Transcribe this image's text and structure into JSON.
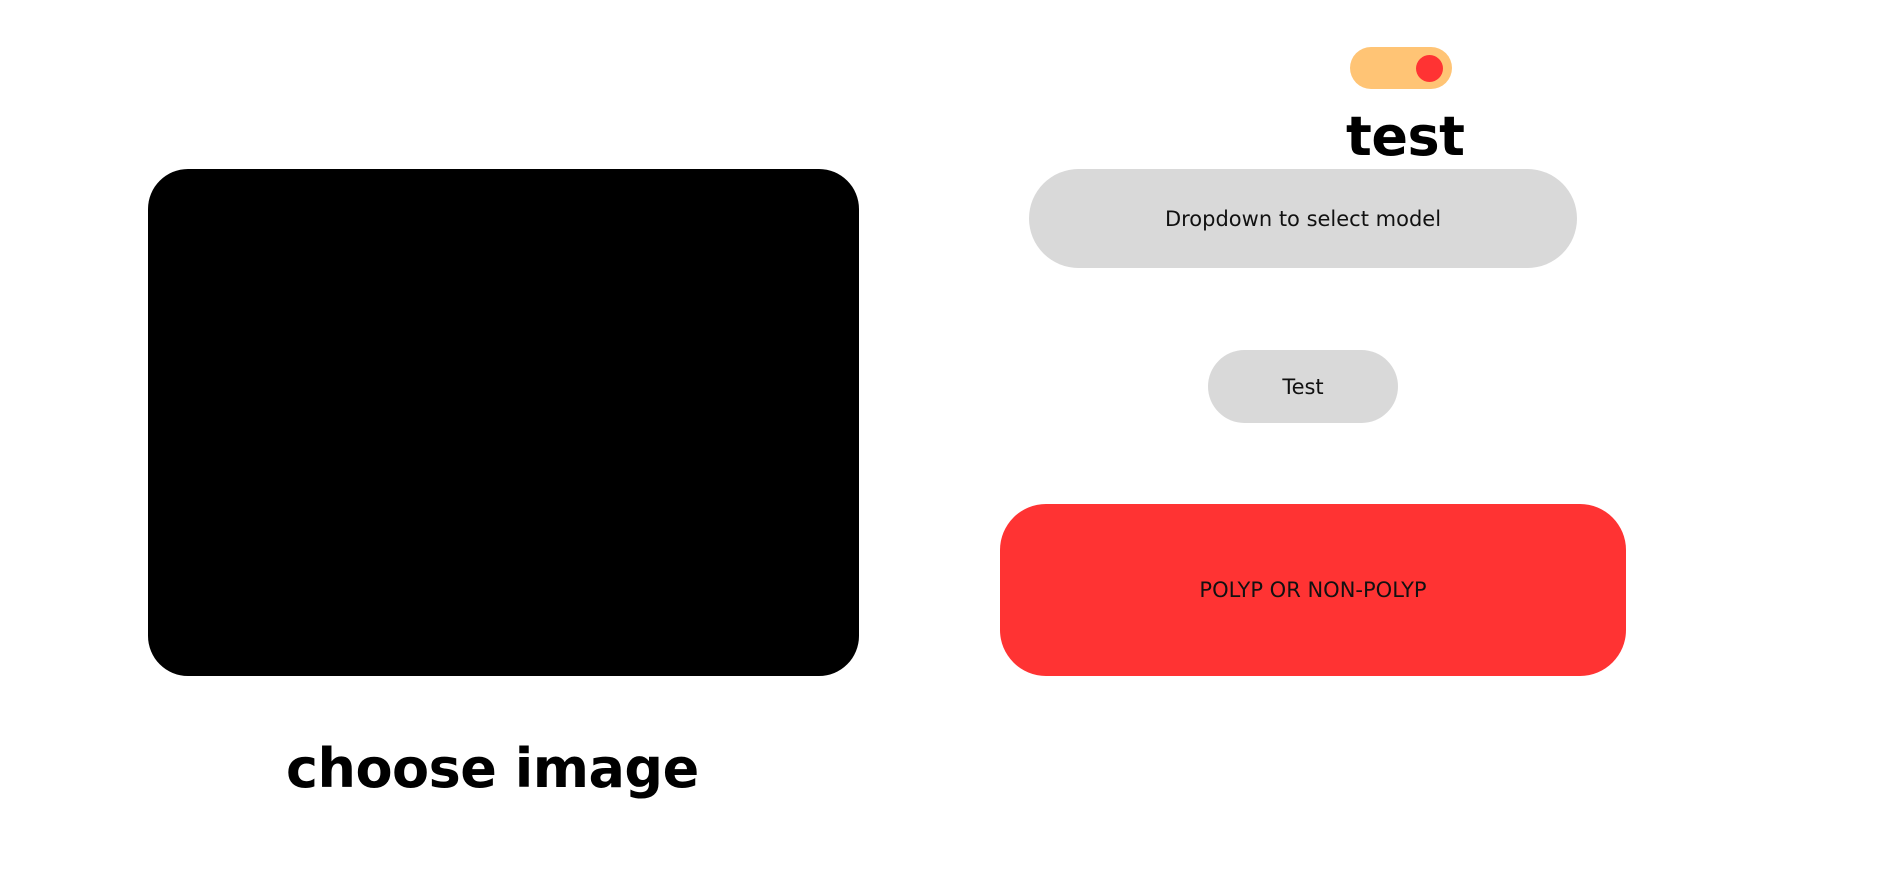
{
  "colors": {
    "background": "#ffffff",
    "image_preview": "#000000",
    "toggle_track": "#ffc475",
    "toggle_knob": "#ff3333",
    "pill_gray": "#d9d9d9",
    "result_red": "#ff3333"
  },
  "upload": {
    "choose_label": "choose image"
  },
  "toggle": {
    "state": "on"
  },
  "mode": {
    "label": "test"
  },
  "controls": {
    "dropdown_label": "Dropdown to select model",
    "test_label": "Test"
  },
  "result": {
    "label": "POLYP OR NON-POLYP"
  }
}
